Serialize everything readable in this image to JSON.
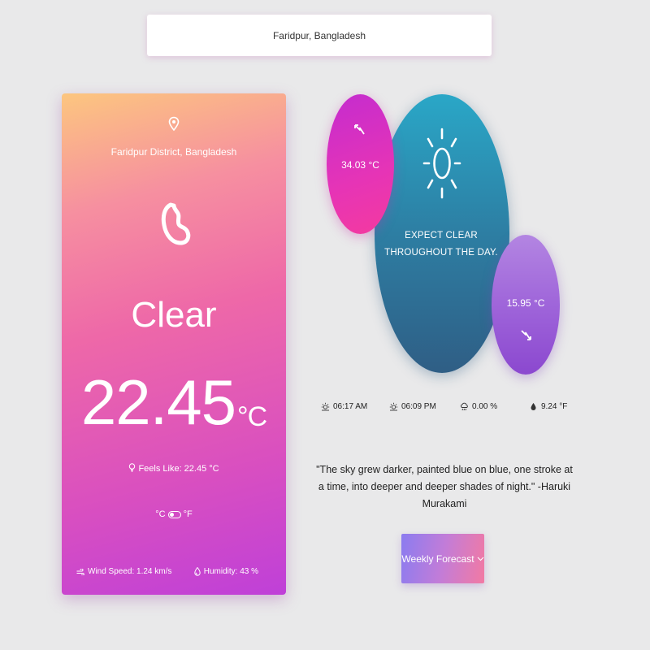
{
  "search": {
    "value": "Faridpur, Bangladesh"
  },
  "card": {
    "location": "Faridpur District, Bangladesh",
    "condition": "Clear",
    "temperature": "22.45",
    "temperature_unit": "°C",
    "feels_like": "Feels Like: 22.45 °C",
    "unit_celsius": "°C",
    "unit_fahrenheit": "°F",
    "wind_speed": "Wind Speed: 1.24 km/s",
    "humidity": "Humidity: 43 %",
    "icons": [
      "location-pin-icon",
      "weather-condition-icon",
      "thermometer-icon",
      "unit-toggle-icon",
      "wind-icon",
      "humidity-drop-icon"
    ]
  },
  "forecast": {
    "description": "EXPECT CLEAR THROUGHOUT THE DAY.",
    "high_temp": "34.03 °C",
    "low_temp": "15.95 °C",
    "icons": [
      "sun-icon",
      "high-arrow-icon",
      "low-arrow-icon"
    ]
  },
  "stats": {
    "sunrise": "06:17 AM",
    "sunset": "06:09 PM",
    "precipitation": "0.00 %",
    "dew_point": "9.24 °F"
  },
  "quote": "\"The sky grew darker, painted blue on blue, one stroke at a time, into deeper and deeper shades of night.\" -Haruki Murakami",
  "weekly_button": {
    "label": "Weekly Forecast"
  },
  "colors": {
    "background": "#e9e9ea",
    "card_gradient_top": "#fcc67f",
    "card_gradient_bottom": "#bf40d8",
    "main_bubble": "#2d7ea3",
    "high_bubble": "#e634b6",
    "low_bubble": "#9b5fd8"
  }
}
